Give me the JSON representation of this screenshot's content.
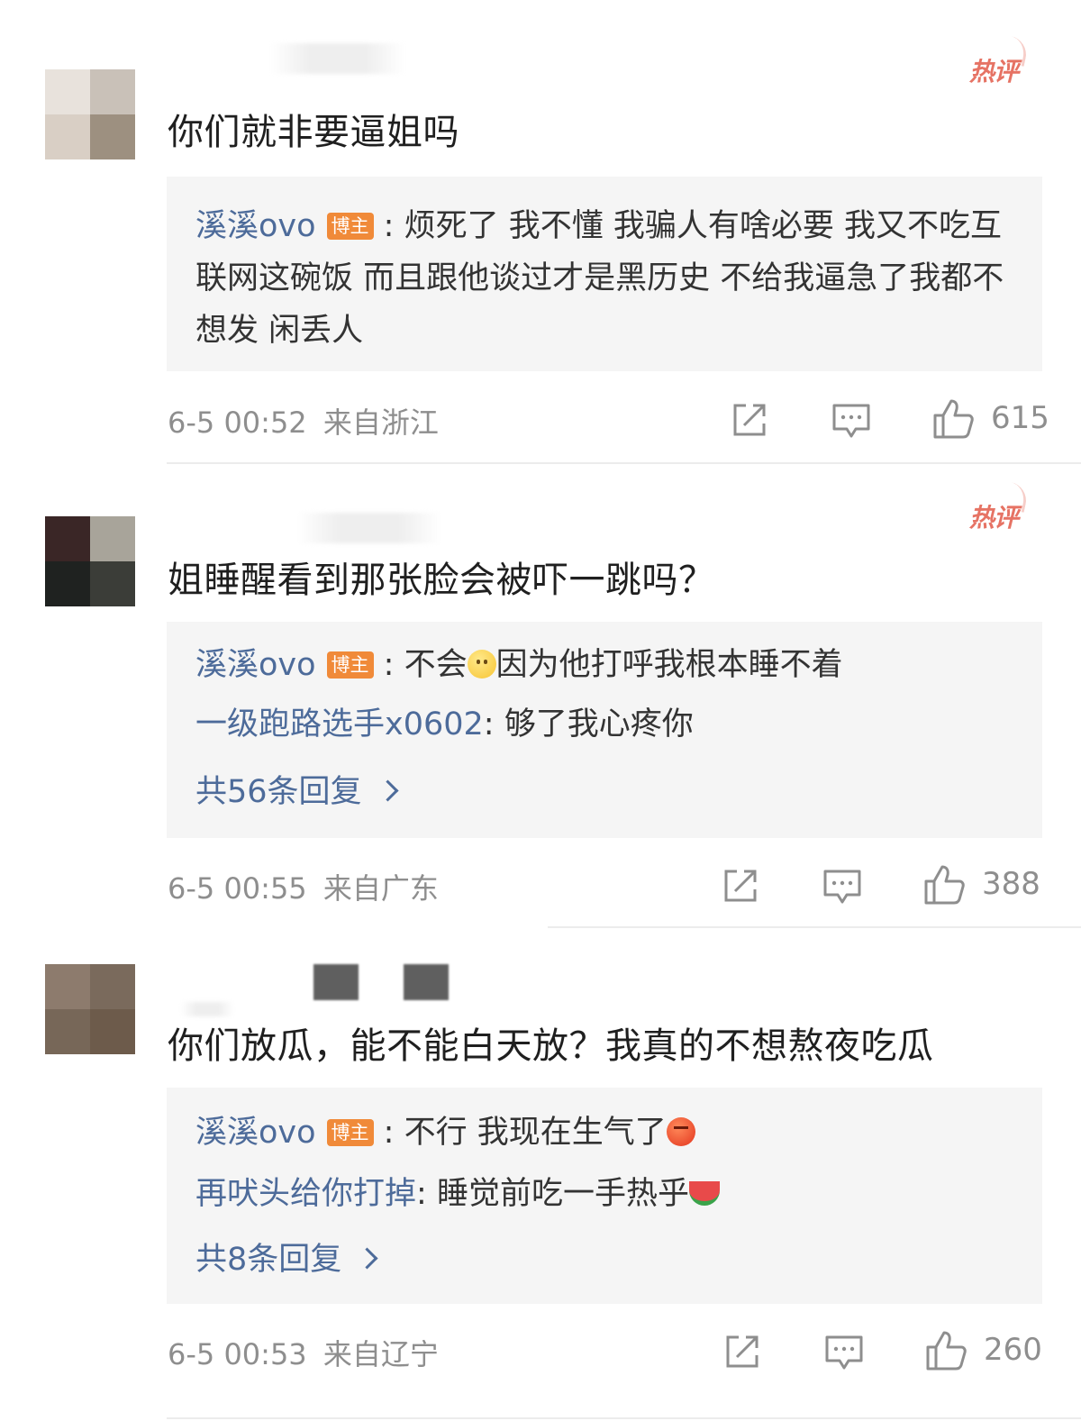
{
  "hot_badge": "热评",
  "author_tag": "博主",
  "colors": {
    "link_blue": "#4d6b9a",
    "author_tag_orange": "#f08a39",
    "hot_red": "#e25b4a",
    "reply_bg": "#f5f5f5",
    "meta_gray": "#8e8e8e"
  },
  "comments": [
    {
      "avatar_colors": [
        "#e8e2dc",
        "#c9c1b8",
        "#d9cfc5",
        "#9d9080"
      ],
      "text": "你们就非要逼姐吗",
      "replies": [
        {
          "name": "溪溪ovo",
          "is_author": true,
          "content": "烦死了 我不懂 我骗人有啥必要 我又不吃互联网这碗饭 而且跟他谈过才是黑历史 不给我逼急了我都不想发 闲丢人"
        }
      ],
      "timestamp": "6-5 00:52",
      "location": "来自浙江",
      "likes": "615",
      "actions": [
        "share-icon",
        "comment-icon",
        "like-icon"
      ]
    },
    {
      "avatar_colors": [
        "#3a2626",
        "#a8a49a",
        "#1f2220",
        "#3b3d38"
      ],
      "text": "姐睡醒看到那张脸会被吓一跳吗？",
      "replies": [
        {
          "name": "溪溪ovo",
          "is_author": true,
          "content_before": "不会",
          "emoji": "smile-emoji",
          "content_after": "因为他打呼我根本睡不着"
        },
        {
          "name": "一级跑路选手x0602",
          "is_author": false,
          "content": "够了我心疼你"
        }
      ],
      "more_replies": "共56条回复",
      "timestamp": "6-5 00:55",
      "location": "来自广东",
      "likes": "388",
      "actions": [
        "share-icon",
        "comment-icon",
        "like-icon"
      ]
    },
    {
      "avatar_colors": [
        "#8d7b6d",
        "#7a6a5c",
        "#776758",
        "#6d5b4b"
      ],
      "text": "你们放瓜，能不能白天放？我真的不想熬夜吃瓜",
      "replies": [
        {
          "name": "溪溪ovo",
          "is_author": true,
          "content": "不行 我现在生气了",
          "emoji": "angry-emoji"
        },
        {
          "name": "再吠头给你打掉",
          "is_author": false,
          "content": "睡觉前吃一手热乎",
          "emoji": "watermelon-emoji"
        }
      ],
      "more_replies": "共8条回复",
      "timestamp": "6-5 00:53",
      "location": "来自辽宁",
      "likes": "260",
      "actions": [
        "share-icon",
        "comment-icon",
        "like-icon"
      ]
    }
  ]
}
